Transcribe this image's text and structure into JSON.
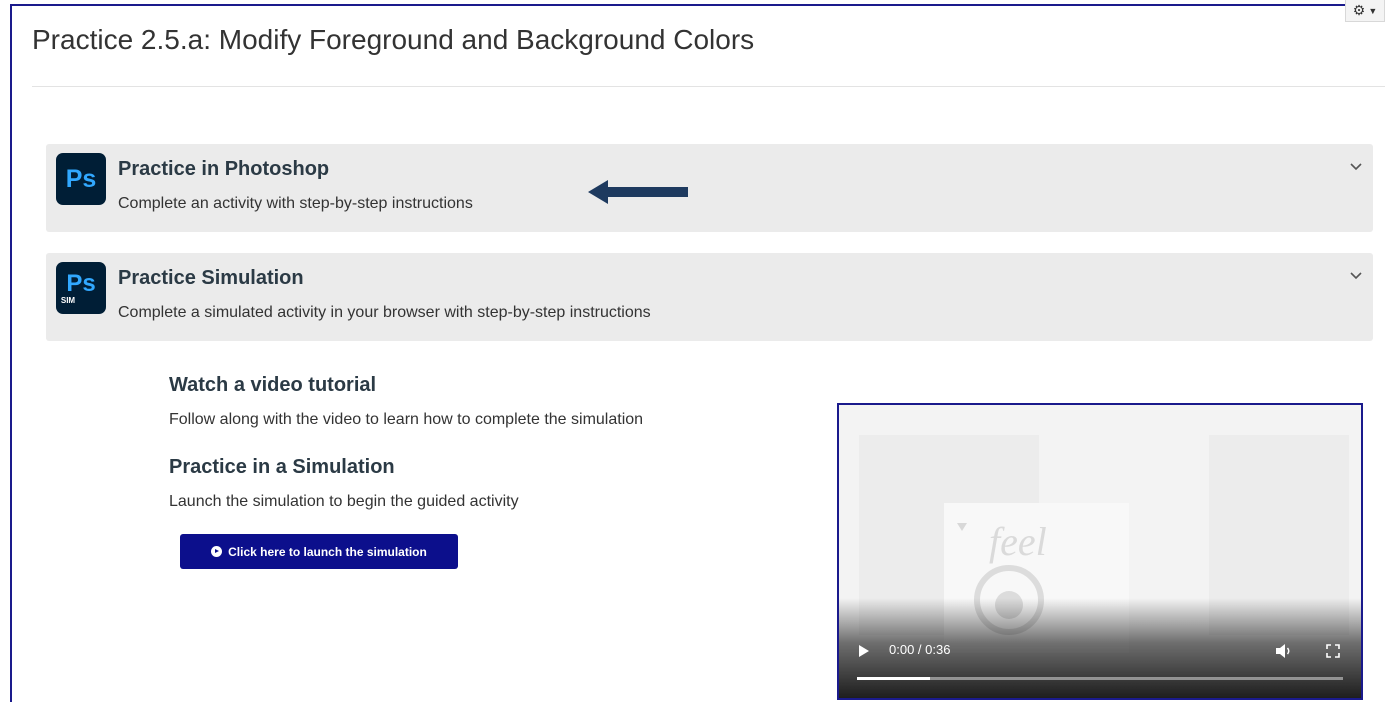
{
  "page": {
    "title": "Practice 2.5.a: Modify Foreground and Background Colors",
    "gear_icon": "gear-icon"
  },
  "panels": [
    {
      "icon_text": "Ps",
      "title": "Practice in Photoshop",
      "subtitle": "Complete an activity with step-by-step instructions",
      "chevron_icon": "chevron-down-icon"
    },
    {
      "icon_text": "Ps",
      "icon_badge": "SIM",
      "title": "Practice Simulation",
      "subtitle": "Complete a simulated activity in your browser with step-by-step instructions",
      "chevron_icon": "chevron-down-icon"
    }
  ],
  "simulation": {
    "video_heading": "Watch a video tutorial",
    "video_text": "Follow along with the video to learn how to complete the simulation",
    "sim_heading": "Practice in a Simulation",
    "sim_text": "Launch the simulation to begin the guided activity",
    "launch_label": "Click here to launch the simulation"
  },
  "video": {
    "time": "0:00 / 0:36",
    "buffered_fraction": 0.15,
    "preview_text": "feel"
  },
  "colors": {
    "accent": "#0c0f8c",
    "panel_bg": "#ebebeb",
    "ps_bg": "#001e36",
    "ps_text": "#31a8ff",
    "arrow": "#1e3a5f"
  }
}
